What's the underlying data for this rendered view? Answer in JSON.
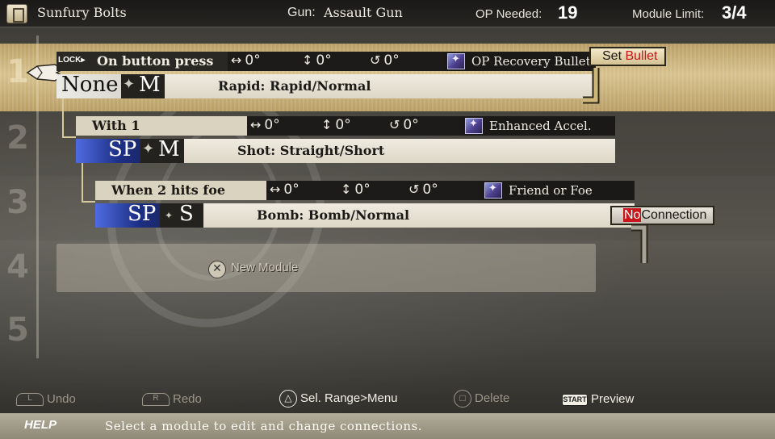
{
  "header": {
    "title": "Sunfury Bolts",
    "gun_label": "Gun:",
    "gun_value": "Assault Gun",
    "op_label": "OP Needed:",
    "op_value": "19",
    "limit_label": "Module  Limit:",
    "limit_value": "3/4"
  },
  "rows": [
    "1",
    "2",
    "3",
    "4",
    "5"
  ],
  "modules": [
    {
      "lock": "LOCK▸",
      "condition": "On button press",
      "horizontal": "0°",
      "vertical": "0°",
      "rotation": "0°",
      "effect": "OP Recovery Bullet",
      "chip_a": "None",
      "chip_b": "M",
      "bullet": "Rapid: Rapid/Normal"
    },
    {
      "condition": "With 1",
      "horizontal": "0°",
      "vertical": "0°",
      "rotation": "0°",
      "effect": "Enhanced Accel.",
      "chip_a": "SP",
      "chip_b": "M",
      "bullet": "Shot: Straight/Short"
    },
    {
      "condition": "When 2 hits foe",
      "horizontal": "0°",
      "vertical": "0°",
      "rotation": "0°",
      "effect": "Friend or Foe",
      "chip_a": "SP",
      "chip_b": "S",
      "bullet": "Bomb: Bomb/Normal"
    }
  ],
  "tags": {
    "set_word": "Set",
    "set_red": "Bullet",
    "no_red": "No",
    "no_word": "Connection"
  },
  "new_module": {
    "label": "New Module",
    "icon": "✕"
  },
  "controls": {
    "undo": "Undo",
    "undo_icon": "L",
    "redo": "Redo",
    "redo_icon": "R",
    "menu": "Sel. Range>Menu",
    "menu_icon": "△",
    "delete": "Delete",
    "delete_icon": "□",
    "preview": "Preview",
    "preview_icon": "START"
  },
  "help": {
    "label": "HELP",
    "text": "Select a module to edit and change connections."
  },
  "colors": {
    "selected_row": "#d7c18d",
    "chip_blue": "#1d2f85",
    "red_accent": "#c9161b"
  }
}
